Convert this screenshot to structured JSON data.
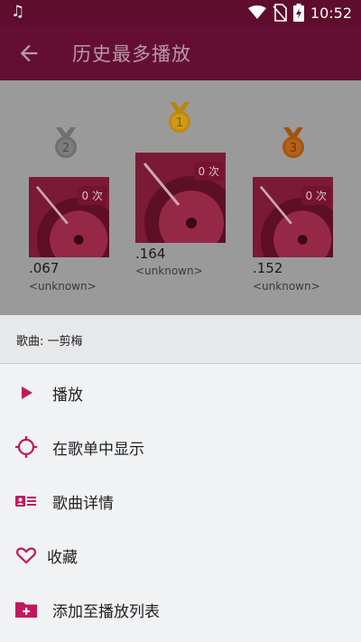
{
  "status_bar": {
    "time": "10:52",
    "icons": [
      "music-note-icon",
      "wifi-icon",
      "no-sim-icon",
      "battery-charging-icon"
    ]
  },
  "app_bar": {
    "title": "历史最多播放",
    "back_icon": "arrow-back-icon"
  },
  "ranking": [
    {
      "rank": "2",
      "play_count": "0 次",
      "title": ".067",
      "artist": "<unknown>",
      "medal_color": "#6f6f6f"
    },
    {
      "rank": "1",
      "play_count": "0 次",
      "title": ".164",
      "artist": "<unknown>",
      "medal_color": "#b8860b"
    },
    {
      "rank": "3",
      "play_count": "0 次",
      "title": ".152",
      "artist": "<unknown>",
      "medal_color": "#a0520f"
    }
  ],
  "sheet": {
    "header": "歌曲: 一剪梅",
    "items": [
      {
        "label": "播放",
        "icon": "play-icon"
      },
      {
        "label": "在歌单中显示",
        "icon": "locate-icon"
      },
      {
        "label": "歌曲详情",
        "icon": "details-card-icon"
      },
      {
        "label": "收藏",
        "icon": "heart-outline-icon"
      },
      {
        "label": "添加至播放列表",
        "icon": "folder-add-icon"
      }
    ]
  },
  "colors": {
    "accent": "#c2185b",
    "app_bar": "#650e33",
    "status_bar": "#5e0d2c"
  }
}
